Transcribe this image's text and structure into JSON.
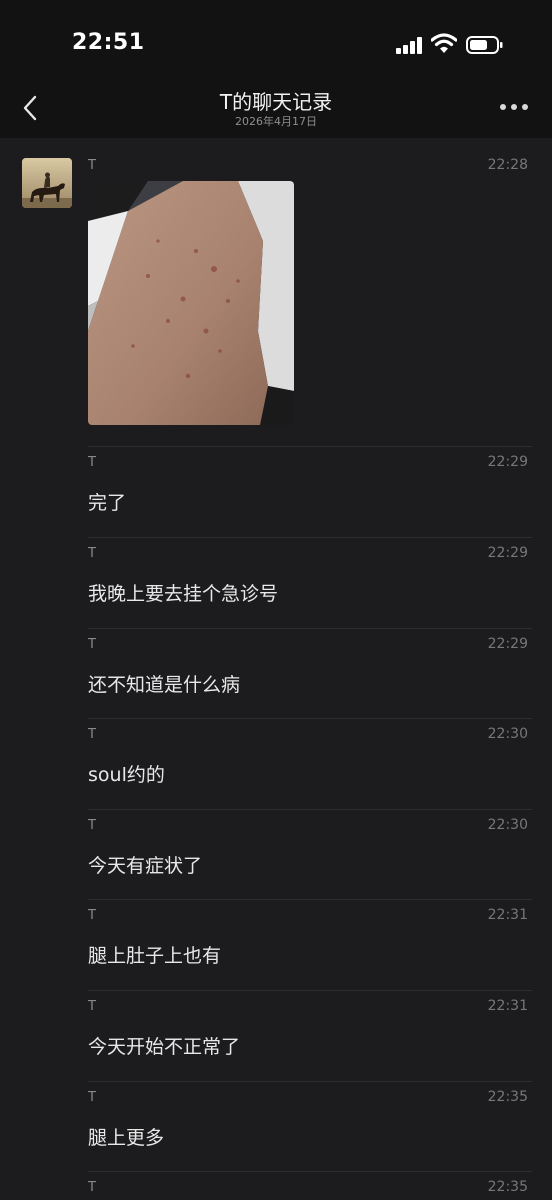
{
  "status_bar": {
    "time": "22:51"
  },
  "header": {
    "title": "T的聊天记录",
    "subtitle": "2026年4月17日"
  },
  "icons": {
    "back": "chevron-left-icon",
    "more": "more-dots-icon",
    "signal": "cellular-signal-icon",
    "wifi": "wifi-icon",
    "battery": "battery-icon"
  },
  "colors": {
    "background": "#1c1c1e",
    "header_background": "#121212",
    "divider": "#2e2e30"
  },
  "messages": [
    {
      "sender": "T",
      "time": "22:28",
      "type": "image"
    },
    {
      "sender": "T",
      "time": "22:29",
      "text": "完了"
    },
    {
      "sender": "T",
      "time": "22:29",
      "text": "我晚上要去挂个急诊号"
    },
    {
      "sender": "T",
      "time": "22:29",
      "text": "还不知道是什么病"
    },
    {
      "sender": "T",
      "time": "22:30",
      "text": "soul约的"
    },
    {
      "sender": "T",
      "time": "22:30",
      "text": "今天有症状了"
    },
    {
      "sender": "T",
      "time": "22:31",
      "text": "腿上肚子上也有"
    },
    {
      "sender": "T",
      "time": "22:31",
      "text": "今天开始不正常了"
    },
    {
      "sender": "T",
      "time": "22:35",
      "text": "腿上更多"
    },
    {
      "sender": "T",
      "time": "22:35"
    }
  ]
}
